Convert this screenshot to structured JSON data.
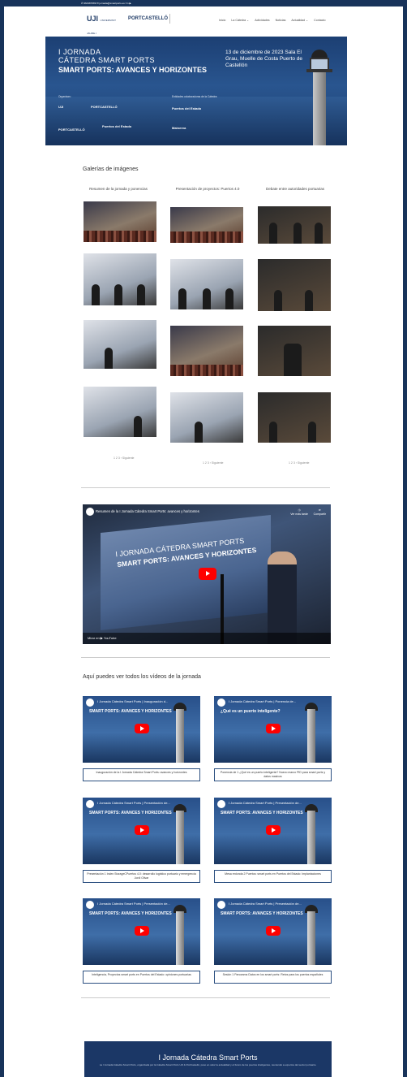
{
  "topbar": {
    "text": "✆ 964387089   ✉ jornada@smartports.es   f   in   ▶"
  },
  "header": {
    "logo_uji": "UJI",
    "logo_uji_sub": "UNIVERSITAT JAUME·I",
    "logo_pc": "PORTCASTELLÓ",
    "nav": [
      "Inicio",
      "La Cátedra ⌄",
      "Actividades",
      "Noticias",
      "Actualidad ⌄",
      "Contacto"
    ]
  },
  "hero": {
    "line1": "I JORNADA",
    "line2": "CÁTEDRA SMART PORTS",
    "line3": "SMART PORTS: AVANCES Y HORIZONTES",
    "date": "13 de diciembre de 2023 Sala El Grau, Muelle de Costa Puerto de Castellón",
    "organizers_label": "Organizan:",
    "collab_label": "Entidades colaboradoras de la Cátedra:",
    "sponsors": [
      "UJI",
      "PORTCASTELLÓ",
      "Puertos del Estado",
      "Puertos del Estado",
      "Mainerva",
      "PORTCASTELLÓ"
    ]
  },
  "gallery": {
    "title": "Galerías de imágenes",
    "columns": [
      {
        "title": "Resumen de la jornada y ponencias",
        "pager": "1  2  3  ›  Siguiente"
      },
      {
        "title": "Presentación de proyectos: Puertos 4.0",
        "pager": "1  2  3  ›  Siguiente"
      },
      {
        "title": "Debate entre autoridades portuarias",
        "pager": "1  2  3  ›  Siguiente"
      }
    ]
  },
  "main_video": {
    "title": "Resumen de la I Jornada Cátedra Smart Ports: avances y horizontes",
    "later_label": "Ver más tarde",
    "share_label": "Compartir",
    "screen_line1": "I JORNADA CÁTEDRA SMART PORTS",
    "screen_line2": "SMART PORTS: AVANCES Y HORIZONTES",
    "watch_on": "Mirar en ▶ YouTube"
  },
  "videos_section": {
    "title": "Aquí puedes ver todos los vídeos de la jornada",
    "items": [
      {
        "title": "I Jornada Cátedra Smart Ports | Inauguración d...",
        "headline": "SMART PORTS: AVANCES Y HORIZONTES",
        "caption": "Inauguración de la I Jornada Cátedra Smart Ports: avances y horizontes"
      },
      {
        "title": "I Jornada Cátedra Smart Ports | Ponencia de...",
        "headline": "¿Qué es un puerto inteligente?",
        "caption": "Ponencia de 1 ¿Qué es un puerto inteligente? Nuevo marco PID para smart ports y datos masivos"
      },
      {
        "title": "I Jornada Cátedra Smart Ports | Presentación de...",
        "headline": "SMART PORTS: AVANCES Y HORIZONTES",
        "caption": "Presentación 1 Index StorageCPuertos 4.0: desarrollo logístico portuario y emergencia Jordi Olivar"
      },
      {
        "title": "I Jornada Cátedra Smart Ports | Presentación de...",
        "headline": "SMART PORTS: AVANCES Y HORIZONTES",
        "caption": "Mesa redonda 2 Puertos: smart ports en Puertos del Estado: Implantaciones"
      },
      {
        "title": "I Jornada Cátedra Smart Ports | Presentación de...",
        "headline": "SMART PORTS: AVANCES Y HORIZONTES",
        "caption": "Inteligencia, Proyectos smart ports en Puertos del Estado: opiniones portuarias"
      },
      {
        "title": "I Jornada Cátedra Smart Ports | Presentación de...",
        "headline": "SMART PORTS: AVANCES Y HORIZONTES",
        "caption": "Sesión 1 Panorama Datos en los smart ports: Retos para los puertos españoles"
      }
    ]
  },
  "footer": {
    "title": "I Jornada Cátedra Smart Ports",
    "text": "La I Jornada Cátedra Smart Ports, organizada por la Cátedra Smart Ports UJI & PortCastelló, puso en valor la actualidad y el futuro de los puertos inteligentes, reuniendo a expertos del sector portuario."
  }
}
